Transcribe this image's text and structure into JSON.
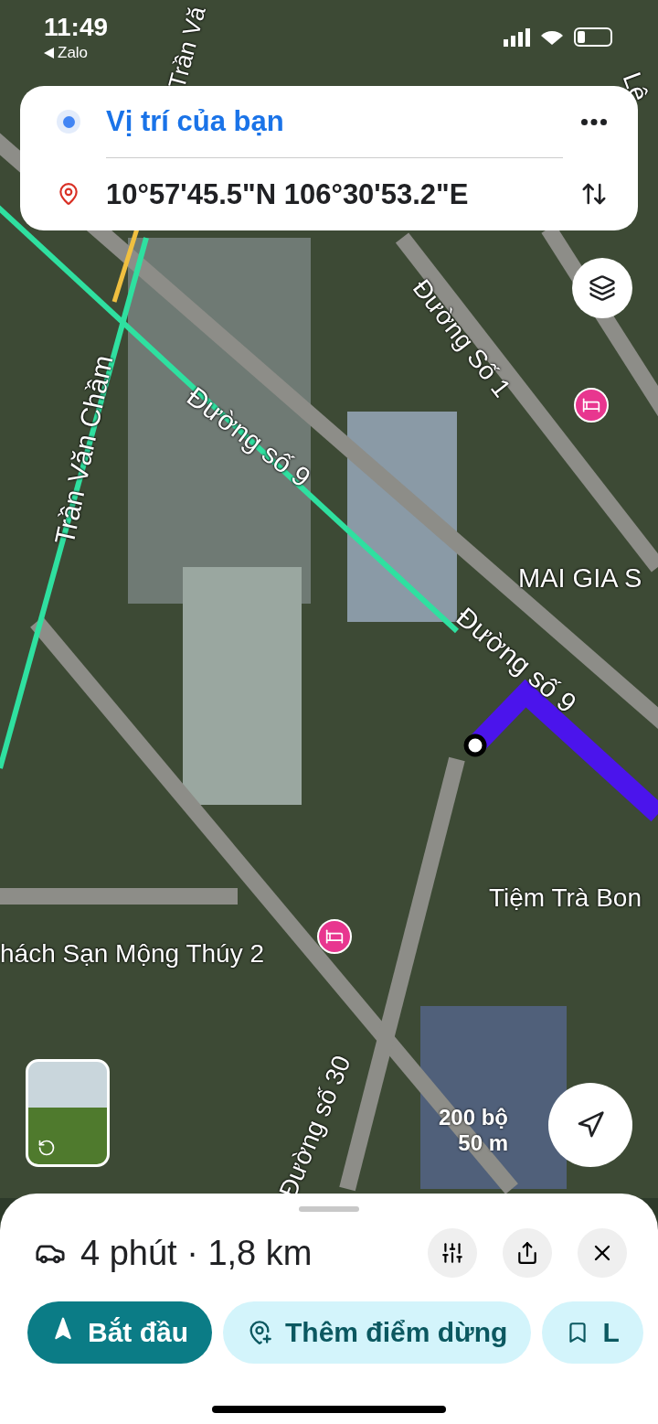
{
  "status_bar": {
    "time": "11:49",
    "back_label": "Zalo"
  },
  "route_card": {
    "origin": "Vị trí của bạn",
    "destination": "10°57'45.5\"N 106°30'53.2\"E"
  },
  "map": {
    "labels": [
      {
        "text": "Trần Vă"
      },
      {
        "text": "Lê"
      },
      {
        "text": "Đường Số 1"
      },
      {
        "text": "Trần Văn Chầm"
      },
      {
        "text": "Đường số 9"
      },
      {
        "text": "Đường số 9"
      },
      {
        "text": "MAI GIA S"
      },
      {
        "text": "Tiệm Trà Bon"
      },
      {
        "text": "hách Sạn Mộng Thúy 2"
      },
      {
        "text": "Đường số 30"
      }
    ],
    "scale": {
      "feet": "200 bộ",
      "meters": "50 m"
    }
  },
  "sheet": {
    "summary": "4 phút · 1,8 km",
    "buttons": [
      {
        "label": "Bắt đầu",
        "kind": "primary"
      },
      {
        "label": "Thêm điểm dừng",
        "kind": "add-stop"
      },
      {
        "label": "L",
        "kind": "save"
      }
    ]
  }
}
